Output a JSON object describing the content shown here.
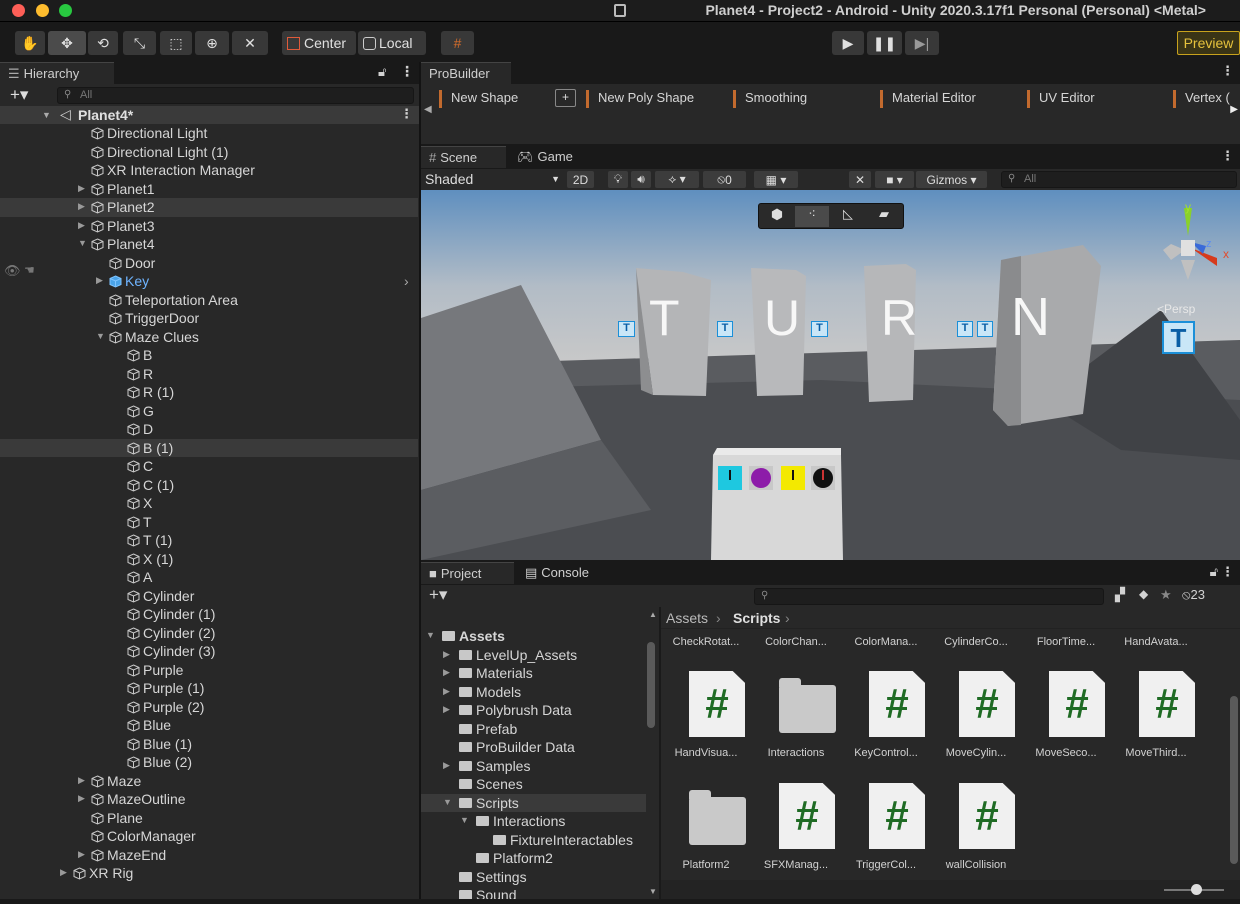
{
  "window": {
    "title": "Planet4 - Project2 - Android - Unity 2020.3.17f1 Personal (Personal) <Metal>"
  },
  "toolbar": {
    "center_label": "Center",
    "local_label": "Local",
    "preview_label": "Preview"
  },
  "hierarchy": {
    "tab_label": "Hierarchy",
    "search_placeholder": "All",
    "scene_name": "Planet4*",
    "items": [
      {
        "label": "Directional Light",
        "depth": 1,
        "arrow": false,
        "selected": false
      },
      {
        "label": "Directional Light (1)",
        "depth": 1,
        "arrow": false,
        "selected": false
      },
      {
        "label": "XR Interaction Manager",
        "depth": 1,
        "arrow": false,
        "selected": false
      },
      {
        "label": "Planet1",
        "depth": 1,
        "arrow": "right",
        "selected": false
      },
      {
        "label": "Planet2",
        "depth": 1,
        "arrow": "right",
        "selected": true
      },
      {
        "label": "Planet3",
        "depth": 1,
        "arrow": "right",
        "selected": false
      },
      {
        "label": "Planet4",
        "depth": 1,
        "arrow": "down",
        "selected": false
      },
      {
        "label": "Door",
        "depth": 2,
        "arrow": false,
        "selected": false
      },
      {
        "label": "Key",
        "depth": 2,
        "arrow": "right",
        "selected": false,
        "highlight": true
      },
      {
        "label": "Teleportation Area",
        "depth": 2,
        "arrow": false,
        "selected": false
      },
      {
        "label": "TriggerDoor",
        "depth": 2,
        "arrow": false,
        "selected": false
      },
      {
        "label": "Maze Clues",
        "depth": 2,
        "arrow": "down",
        "selected": false
      },
      {
        "label": "B",
        "depth": 3,
        "arrow": false,
        "selected": false
      },
      {
        "label": "R",
        "depth": 3,
        "arrow": false,
        "selected": false
      },
      {
        "label": "R (1)",
        "depth": 3,
        "arrow": false,
        "selected": false
      },
      {
        "label": "G",
        "depth": 3,
        "arrow": false,
        "selected": false
      },
      {
        "label": "D",
        "depth": 3,
        "arrow": false,
        "selected": false
      },
      {
        "label": "B (1)",
        "depth": 3,
        "arrow": false,
        "selected": true
      },
      {
        "label": "C",
        "depth": 3,
        "arrow": false,
        "selected": false
      },
      {
        "label": "C (1)",
        "depth": 3,
        "arrow": false,
        "selected": false
      },
      {
        "label": "X",
        "depth": 3,
        "arrow": false,
        "selected": false
      },
      {
        "label": "T",
        "depth": 3,
        "arrow": false,
        "selected": false
      },
      {
        "label": "T (1)",
        "depth": 3,
        "arrow": false,
        "selected": false
      },
      {
        "label": "X (1)",
        "depth": 3,
        "arrow": false,
        "selected": false
      },
      {
        "label": "A",
        "depth": 3,
        "arrow": false,
        "selected": false
      },
      {
        "label": "Cylinder",
        "depth": 3,
        "arrow": false,
        "selected": false
      },
      {
        "label": "Cylinder (1)",
        "depth": 3,
        "arrow": false,
        "selected": false
      },
      {
        "label": "Cylinder (2)",
        "depth": 3,
        "arrow": false,
        "selected": false
      },
      {
        "label": "Cylinder (3)",
        "depth": 3,
        "arrow": false,
        "selected": false
      },
      {
        "label": "Purple",
        "depth": 3,
        "arrow": false,
        "selected": false
      },
      {
        "label": "Purple (1)",
        "depth": 3,
        "arrow": false,
        "selected": false
      },
      {
        "label": "Purple (2)",
        "depth": 3,
        "arrow": false,
        "selected": false
      },
      {
        "label": "Blue",
        "depth": 3,
        "arrow": false,
        "selected": false
      },
      {
        "label": "Blue (1)",
        "depth": 3,
        "arrow": false,
        "selected": false
      },
      {
        "label": "Blue (2)",
        "depth": 3,
        "arrow": false,
        "selected": false
      },
      {
        "label": "Maze",
        "depth": 1,
        "arrow": "right",
        "selected": false
      },
      {
        "label": "MazeOutline",
        "depth": 1,
        "arrow": "right",
        "selected": false
      },
      {
        "label": "Plane",
        "depth": 1,
        "arrow": false,
        "selected": false
      },
      {
        "label": "ColorManager",
        "depth": 1,
        "arrow": false,
        "selected": false
      },
      {
        "label": "MazeEnd",
        "depth": 1,
        "arrow": "right",
        "selected": false
      },
      {
        "label": "XR Rig",
        "depth": 0,
        "arrow": "right",
        "selected": false
      }
    ]
  },
  "probuilder": {
    "tab_label": "ProBuilder",
    "items": [
      "New Shape",
      "+",
      "New Poly Shape",
      "Smoothing",
      "Material Editor",
      "UV Editor",
      "Vertex ("
    ]
  },
  "scene": {
    "tabs": [
      "Scene",
      "Game"
    ],
    "shading_mode": "Shaded",
    "mode_2d": "2D",
    "hidden_count": "0",
    "gizmos_label": "Gizmos",
    "search_placeholder": "All",
    "persp_label": "<Persp",
    "gizmo_y": "y",
    "gizmo_z": "z",
    "gizmo_x": "x",
    "pillar_letters": [
      "T",
      "U",
      "R",
      "N"
    ],
    "small_t": "T"
  },
  "project": {
    "tabs": [
      "Project",
      "Console"
    ],
    "hidden_count": "23",
    "breadcrumb_root": "Assets",
    "breadcrumb_current": "Scripts",
    "tree": [
      {
        "label": "Assets",
        "depth": 0,
        "arrow": "down",
        "bold": true,
        "selected": false
      },
      {
        "label": "LevelUp_Assets",
        "depth": 1,
        "arrow": "right",
        "selected": false
      },
      {
        "label": "Materials",
        "depth": 1,
        "arrow": "right",
        "selected": false
      },
      {
        "label": "Models",
        "depth": 1,
        "arrow": "right",
        "selected": false
      },
      {
        "label": "Polybrush Data",
        "depth": 1,
        "arrow": "right",
        "selected": false
      },
      {
        "label": "Prefab",
        "depth": 1,
        "arrow": false,
        "selected": false
      },
      {
        "label": "ProBuilder Data",
        "depth": 1,
        "arrow": false,
        "selected": false
      },
      {
        "label": "Samples",
        "depth": 1,
        "arrow": "right",
        "selected": false
      },
      {
        "label": "Scenes",
        "depth": 1,
        "arrow": false,
        "selected": false
      },
      {
        "label": "Scripts",
        "depth": 1,
        "arrow": "down",
        "selected": true
      },
      {
        "label": "Interactions",
        "depth": 2,
        "arrow": "down",
        "selected": false
      },
      {
        "label": "FixtureInteractables",
        "depth": 3,
        "arrow": false,
        "selected": false
      },
      {
        "label": "Platform2",
        "depth": 2,
        "arrow": false,
        "selected": false
      },
      {
        "label": "Settings",
        "depth": 1,
        "arrow": false,
        "selected": false
      },
      {
        "label": "Sound",
        "depth": 1,
        "arrow": false,
        "selected": false
      }
    ],
    "top_row_labels": [
      "CheckRotat...",
      "ColorChan...",
      "ColorMana...",
      "CylinderCo...",
      "FloorTime...",
      "HandAvata..."
    ],
    "assets": [
      {
        "label": "HandVisua...",
        "kind": "script"
      },
      {
        "label": "Interactions",
        "kind": "folder"
      },
      {
        "label": "KeyControl...",
        "kind": "script"
      },
      {
        "label": "MoveCylin...",
        "kind": "script"
      },
      {
        "label": "MoveSeco...",
        "kind": "script"
      },
      {
        "label": "MoveThird...",
        "kind": "script"
      },
      {
        "label": "Platform2",
        "kind": "folder"
      },
      {
        "label": "SFXManag...",
        "kind": "script"
      },
      {
        "label": "TriggerCol...",
        "kind": "script"
      },
      {
        "label": "wallCollision",
        "kind": "script"
      }
    ],
    "script_glyph": "#"
  }
}
